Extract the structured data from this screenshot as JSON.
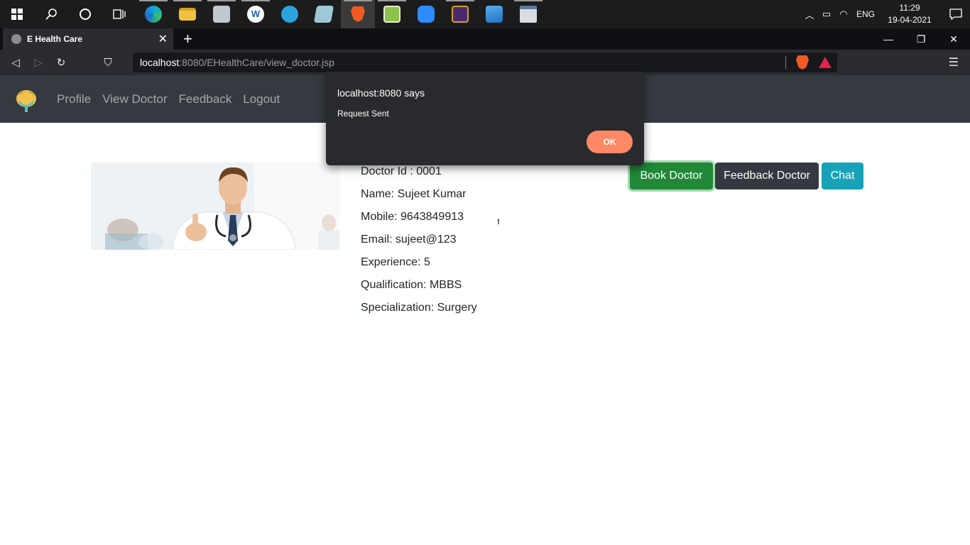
{
  "taskbar": {
    "apps": [
      {
        "name": "start",
        "icon": "windows-logo-icon"
      },
      {
        "name": "search",
        "icon": "search-icon"
      },
      {
        "name": "cortana",
        "icon": "cortana-circle-icon"
      },
      {
        "name": "task-view",
        "icon": "task-view-icon"
      },
      {
        "name": "edge",
        "icon": "edge-icon",
        "color": "#1e90d8"
      },
      {
        "name": "file-explorer",
        "icon": "folder-icon",
        "color": "#f0c040"
      },
      {
        "name": "control",
        "icon": "monitor-app-icon",
        "color": "#c0c8d0"
      },
      {
        "name": "app-w",
        "icon": "w-app-icon",
        "color": "#ffffff"
      },
      {
        "name": "telegram",
        "icon": "telegram-icon",
        "color": "#2aa3df"
      },
      {
        "name": "notes",
        "icon": "notes-app-icon",
        "color": "#9ec8d6"
      },
      {
        "name": "brave",
        "icon": "brave-icon",
        "color": "#f25a23"
      },
      {
        "name": "editor",
        "icon": "notepad-plus-icon",
        "color": "#8bc34a"
      },
      {
        "name": "zoom",
        "icon": "zoom-icon",
        "color": "#2d8cff"
      },
      {
        "name": "game",
        "icon": "game-app-icon",
        "color": "#4a2a6a"
      },
      {
        "name": "photos",
        "icon": "photos-icon",
        "color": "#1e6fc0"
      },
      {
        "name": "window-app",
        "icon": "window-app-icon",
        "color": "#d8dde2"
      }
    ],
    "tray": {
      "language": "ENG",
      "time": "11:29",
      "date": "19-04-2021"
    }
  },
  "browser": {
    "tab_title": "E Health Care",
    "url_host": "localhost",
    "url_rest": ":8080/EHealthCare/view_doctor.jsp"
  },
  "site": {
    "nav": {
      "profile": "Profile",
      "view_doctor": "View Doctor",
      "feedback": "Feedback",
      "logout": "Logout"
    },
    "doctor": {
      "id": "Doctor Id : 0001",
      "name": "Name: Sujeet Kumar",
      "mobile": "Mobile: 9643849913",
      "email": "Email: sujeet@123",
      "experience": "Experience: 5",
      "qualification": "Qualification: MBBS",
      "specialization": "Specialization: Surgery"
    },
    "buttons": {
      "book": "Book Doctor",
      "feedback": "Feedback Doctor",
      "chat": "Chat"
    }
  },
  "dialog": {
    "title": "localhost:8080 says",
    "message": "Request Sent",
    "ok": "OK"
  }
}
